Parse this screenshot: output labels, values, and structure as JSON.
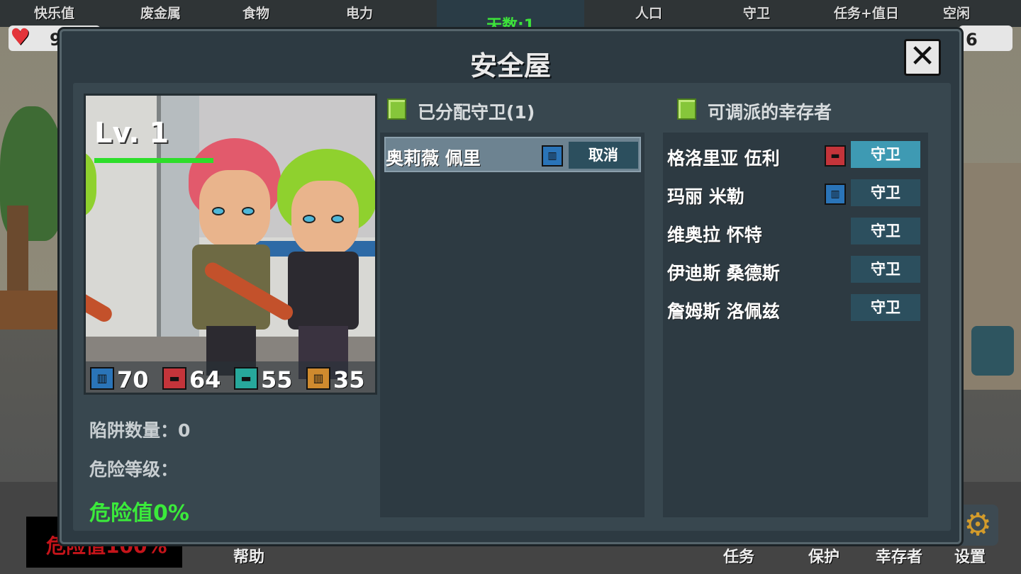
{
  "topbar": {
    "resources": [
      "快乐值",
      "废金属",
      "食物",
      "电力",
      "人口",
      "守卫",
      "任务+值日",
      "空闲"
    ],
    "day_label": "天数:1",
    "happiness_partial": "9",
    "idle_value": "6"
  },
  "bottombar": {
    "danger_text": "危险值100%",
    "help": "帮助",
    "task": "任务",
    "protect": "保护",
    "survivors": "幸存者",
    "settings": "设置"
  },
  "modal": {
    "title": "安全屋",
    "close_glyph": "✕",
    "portrait": {
      "level": "Lv. 1",
      "stats": [
        {
          "icon": "defense-icon",
          "color": "#2a74b8",
          "glyph": "▥",
          "value": "70"
        },
        {
          "icon": "gun-icon-red",
          "color": "#c4343a",
          "glyph": "▬",
          "value": "64"
        },
        {
          "icon": "gun-icon-teal",
          "color": "#27a89b",
          "glyph": "▬",
          "value": "55"
        },
        {
          "icon": "supply-icon",
          "color": "#cf8a2e",
          "glyph": "▥",
          "value": "35"
        }
      ]
    },
    "trap_count_label": "陷阱数量：",
    "trap_count_value": "0",
    "danger_level_label": "危险等级：",
    "danger_value": "危险值0%",
    "assigned": {
      "header": "已分配守卫(1)",
      "rows": [
        {
          "name": "奥莉薇 佩里",
          "skill_color": "#2a74b8",
          "skill_glyph": "▥",
          "action": "取消"
        }
      ]
    },
    "available": {
      "header": "可调派的幸存者",
      "rows": [
        {
          "name": "格洛里亚 伍利",
          "skill_color": "#c4343a",
          "skill_glyph": "▬",
          "action": "守卫",
          "active": true
        },
        {
          "name": "玛丽 米勒",
          "skill_color": "#2a74b8",
          "skill_glyph": "▥",
          "action": "守卫",
          "active": false
        },
        {
          "name": "维奥拉 怀特",
          "skill_color": "",
          "skill_glyph": "",
          "action": "守卫",
          "active": false
        },
        {
          "name": "伊迪斯 桑德斯",
          "skill_color": "",
          "skill_glyph": "",
          "action": "守卫",
          "active": false
        },
        {
          "name": "詹姆斯 洛佩兹",
          "skill_color": "",
          "skill_glyph": "",
          "action": "守卫",
          "active": false
        }
      ]
    }
  }
}
